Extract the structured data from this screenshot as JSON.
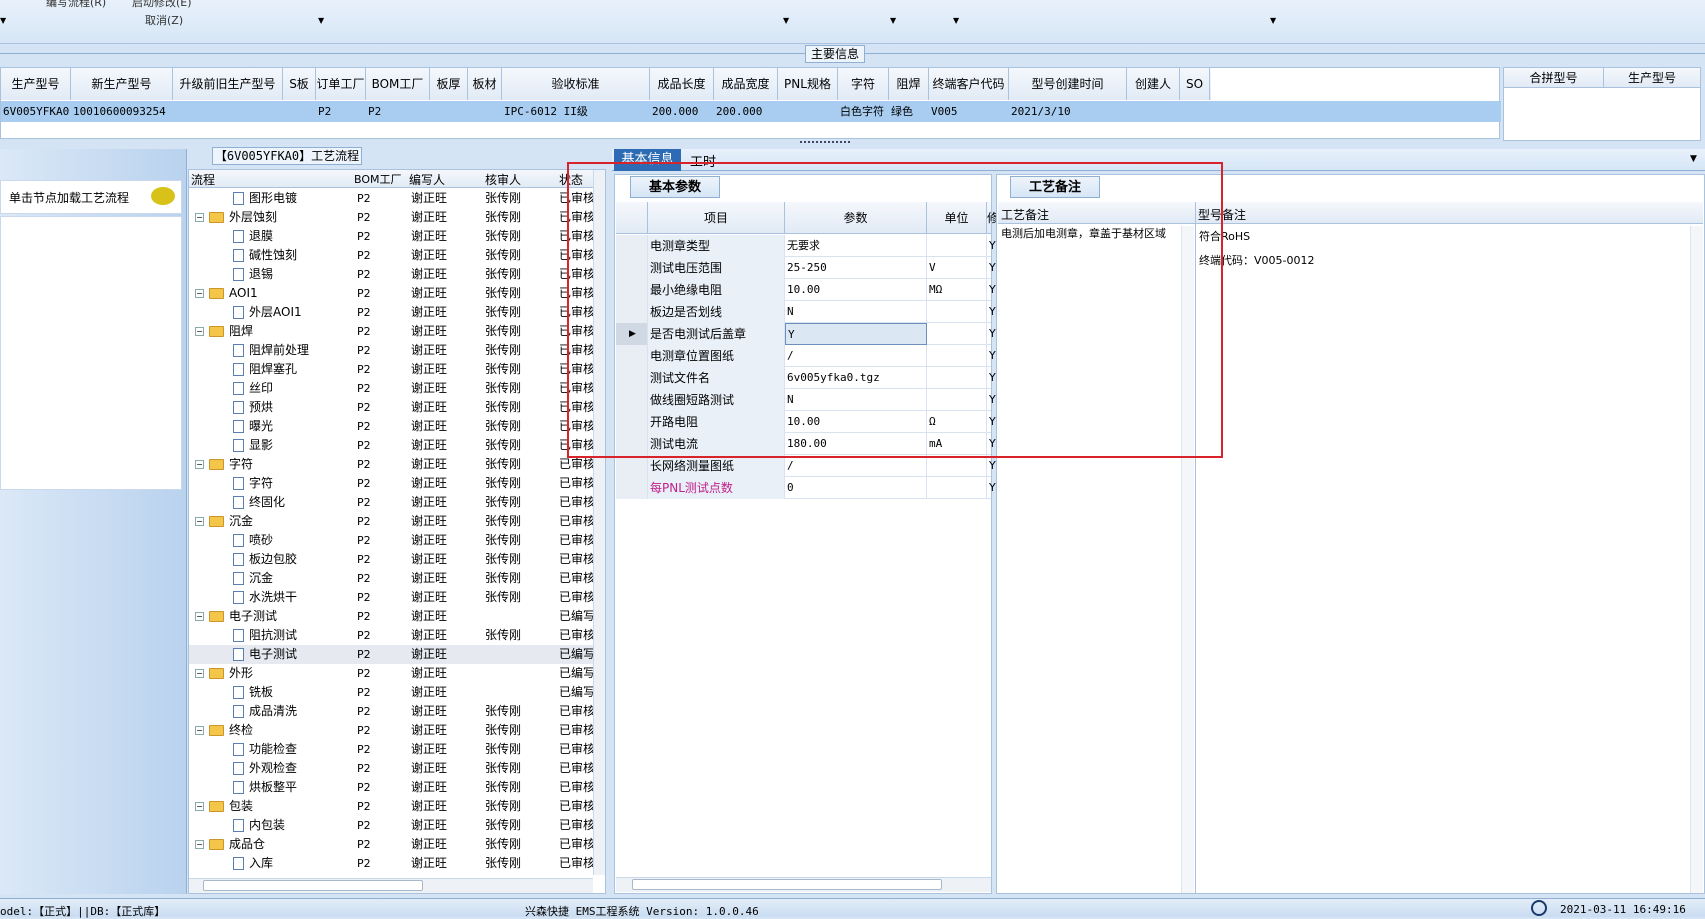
{
  "toolbar": {
    "edit_flow": "编写流程(R)",
    "start_modify": "启动修改(E)",
    "cancel": "取消(Z)"
  },
  "main_info": {
    "section_title": "主要信息",
    "columns": [
      "生产型号",
      "新生产型号",
      "升级前旧生产型号",
      "S板",
      "订单工厂",
      "BOM工厂",
      "板厚",
      "板材",
      "验收标准",
      "成品长度",
      "成品宽度",
      "PNL规格",
      "字符",
      "阻焊",
      "终端客户代码",
      "型号创建时间",
      "创建人",
      "SO"
    ],
    "row": [
      "6V005YFKA0",
      "10010600093254",
      "",
      "",
      "P2",
      "P2",
      "",
      "",
      "IPC-6012 II级",
      "200.000",
      "200.000",
      "",
      "白色字符",
      "绿色",
      "V005",
      "2021/3/10",
      "",
      ""
    ],
    "side_columns": [
      "合拼型号",
      "生产型号"
    ]
  },
  "process": {
    "title": "【6V005YFKA0】工艺流程",
    "load_hint": "单击节点加载工艺流程",
    "tree_columns": [
      "流程",
      "BOM工厂",
      "编写人",
      "核审人",
      "状态"
    ],
    "rows": [
      {
        "name": "图形电镀",
        "lvl": 2,
        "bom": "P2",
        "writer": "谢正旺",
        "reviewer": "张传刚",
        "status": "已审核"
      },
      {
        "name": "外层蚀刻",
        "lvl": 1,
        "bom": "P2",
        "writer": "谢正旺",
        "reviewer": "张传刚",
        "status": "已审核"
      },
      {
        "name": "退膜",
        "lvl": 2,
        "bom": "P2",
        "writer": "谢正旺",
        "reviewer": "张传刚",
        "status": "已审核"
      },
      {
        "name": "碱性蚀刻",
        "lvl": 2,
        "bom": "P2",
        "writer": "谢正旺",
        "reviewer": "张传刚",
        "status": "已审核"
      },
      {
        "name": "退锡",
        "lvl": 2,
        "bom": "P2",
        "writer": "谢正旺",
        "reviewer": "张传刚",
        "status": "已审核"
      },
      {
        "name": "AOI1",
        "lvl": 1,
        "bom": "P2",
        "writer": "谢正旺",
        "reviewer": "张传刚",
        "status": "已审核"
      },
      {
        "name": "外层AOI1",
        "lvl": 2,
        "bom": "P2",
        "writer": "谢正旺",
        "reviewer": "张传刚",
        "status": "已审核"
      },
      {
        "name": "阻焊",
        "lvl": 1,
        "bom": "P2",
        "writer": "谢正旺",
        "reviewer": "张传刚",
        "status": "已审核"
      },
      {
        "name": "阻焊前处理",
        "lvl": 2,
        "bom": "P2",
        "writer": "谢正旺",
        "reviewer": "张传刚",
        "status": "已审核"
      },
      {
        "name": "阻焊塞孔",
        "lvl": 2,
        "bom": "P2",
        "writer": "谢正旺",
        "reviewer": "张传刚",
        "status": "已审核"
      },
      {
        "name": "丝印",
        "lvl": 2,
        "bom": "P2",
        "writer": "谢正旺",
        "reviewer": "张传刚",
        "status": "已审核"
      },
      {
        "name": "预烘",
        "lvl": 2,
        "bom": "P2",
        "writer": "谢正旺",
        "reviewer": "张传刚",
        "status": "已审核"
      },
      {
        "name": "曝光",
        "lvl": 2,
        "bom": "P2",
        "writer": "谢正旺",
        "reviewer": "张传刚",
        "status": "已审核"
      },
      {
        "name": "显影",
        "lvl": 2,
        "bom": "P2",
        "writer": "谢正旺",
        "reviewer": "张传刚",
        "status": "已审核"
      },
      {
        "name": "字符",
        "lvl": 1,
        "bom": "P2",
        "writer": "谢正旺",
        "reviewer": "张传刚",
        "status": "已审核"
      },
      {
        "name": "字符",
        "lvl": 2,
        "bom": "P2",
        "writer": "谢正旺",
        "reviewer": "张传刚",
        "status": "已审核"
      },
      {
        "name": "终固化",
        "lvl": 2,
        "bom": "P2",
        "writer": "谢正旺",
        "reviewer": "张传刚",
        "status": "已审核"
      },
      {
        "name": "沉金",
        "lvl": 1,
        "bom": "P2",
        "writer": "谢正旺",
        "reviewer": "张传刚",
        "status": "已审核"
      },
      {
        "name": "喷砂",
        "lvl": 2,
        "bom": "P2",
        "writer": "谢正旺",
        "reviewer": "张传刚",
        "status": "已审核"
      },
      {
        "name": "板边包胶",
        "lvl": 2,
        "bom": "P2",
        "writer": "谢正旺",
        "reviewer": "张传刚",
        "status": "已审核"
      },
      {
        "name": "沉金",
        "lvl": 2,
        "bom": "P2",
        "writer": "谢正旺",
        "reviewer": "张传刚",
        "status": "已审核"
      },
      {
        "name": "水洗烘干",
        "lvl": 2,
        "bom": "P2",
        "writer": "谢正旺",
        "reviewer": "张传刚",
        "status": "已审核"
      },
      {
        "name": "电子测试",
        "lvl": 1,
        "bom": "P2",
        "writer": "谢正旺",
        "reviewer": "",
        "status": "已编写"
      },
      {
        "name": "阻抗测试",
        "lvl": 2,
        "bom": "P2",
        "writer": "谢正旺",
        "reviewer": "张传刚",
        "status": "已审核"
      },
      {
        "name": "电子测试",
        "lvl": 2,
        "bom": "P2",
        "writer": "谢正旺",
        "reviewer": "",
        "status": "已编写",
        "selected": true
      },
      {
        "name": "外形",
        "lvl": 1,
        "bom": "P2",
        "writer": "谢正旺",
        "reviewer": "",
        "status": "已编写"
      },
      {
        "name": "铣板",
        "lvl": 2,
        "bom": "P2",
        "writer": "谢正旺",
        "reviewer": "",
        "status": "已编写"
      },
      {
        "name": "成品清洗",
        "lvl": 2,
        "bom": "P2",
        "writer": "谢正旺",
        "reviewer": "张传刚",
        "status": "已审核"
      },
      {
        "name": "终检",
        "lvl": 1,
        "bom": "P2",
        "writer": "谢正旺",
        "reviewer": "张传刚",
        "status": "已审核"
      },
      {
        "name": "功能检查",
        "lvl": 2,
        "bom": "P2",
        "writer": "谢正旺",
        "reviewer": "张传刚",
        "status": "已审核"
      },
      {
        "name": "外观检查",
        "lvl": 2,
        "bom": "P2",
        "writer": "谢正旺",
        "reviewer": "张传刚",
        "status": "已审核"
      },
      {
        "name": "烘板整平",
        "lvl": 2,
        "bom": "P2",
        "writer": "谢正旺",
        "reviewer": "张传刚",
        "status": "已审核"
      },
      {
        "name": "包装",
        "lvl": 1,
        "bom": "P2",
        "writer": "谢正旺",
        "reviewer": "张传刚",
        "status": "已审核"
      },
      {
        "name": "内包装",
        "lvl": 2,
        "bom": "P2",
        "writer": "谢正旺",
        "reviewer": "张传刚",
        "status": "已审核"
      },
      {
        "name": "成品仓",
        "lvl": 1,
        "bom": "P2",
        "writer": "谢正旺",
        "reviewer": "张传刚",
        "status": "已审核"
      },
      {
        "name": "入库",
        "lvl": 2,
        "bom": "P2",
        "writer": "谢正旺",
        "reviewer": "张传刚",
        "status": "已审核"
      }
    ]
  },
  "tabs": {
    "basic_info": "基本信息",
    "work_hours": "工时"
  },
  "basic_params": {
    "title": "基本参数",
    "columns": [
      "项目",
      "参数",
      "单位",
      "修"
    ],
    "rows": [
      {
        "item": "电测章类型",
        "param": "无要求",
        "unit": "",
        "flag": "Y"
      },
      {
        "item": "测试电压范围",
        "param": "25-250",
        "unit": "V",
        "flag": "Y"
      },
      {
        "item": "最小绝缘电阻",
        "param": "10.00",
        "unit": "MΩ",
        "flag": "Y"
      },
      {
        "item": "板边是否划线",
        "param": "N",
        "unit": "",
        "flag": "Y"
      },
      {
        "item": "是否电测试后盖章",
        "param": "Y",
        "unit": "",
        "flag": "Y",
        "selected": true
      },
      {
        "item": "电测章位置图纸",
        "param": "/",
        "unit": "",
        "flag": "Y"
      },
      {
        "item": "测试文件名",
        "param": "6v005yfka0.tgz",
        "unit": "",
        "flag": "Y"
      },
      {
        "item": "做线圈短路测试",
        "param": "N",
        "unit": "",
        "flag": "Y"
      },
      {
        "item": "开路电阻",
        "param": "10.00",
        "unit": "Ω",
        "flag": "Y"
      },
      {
        "item": "测试电流",
        "param": "180.00",
        "unit": "mA",
        "flag": "Y"
      },
      {
        "item": "长网络测量图纸",
        "param": "/",
        "unit": "",
        "flag": "Y"
      },
      {
        "item": "每PNL测试点数",
        "param": "0",
        "unit": "",
        "flag": "Y",
        "highlight": true
      }
    ]
  },
  "process_notes": {
    "title": "工艺备注",
    "col_process_note": "工艺备注",
    "col_model_note": "型号备注",
    "process_note_text": "电测后加电测章，章盖于基材区域",
    "model_note_line1": "符合RoHS",
    "model_note_line2": "终端代码：V005-0012"
  },
  "status_bar": {
    "left": "odel:【正式】||DB:【正式库】",
    "center": "兴森快捷 EMS工程系统 Version: 1.0.0.46",
    "datetime": "2021-03-11 16:49:16"
  }
}
